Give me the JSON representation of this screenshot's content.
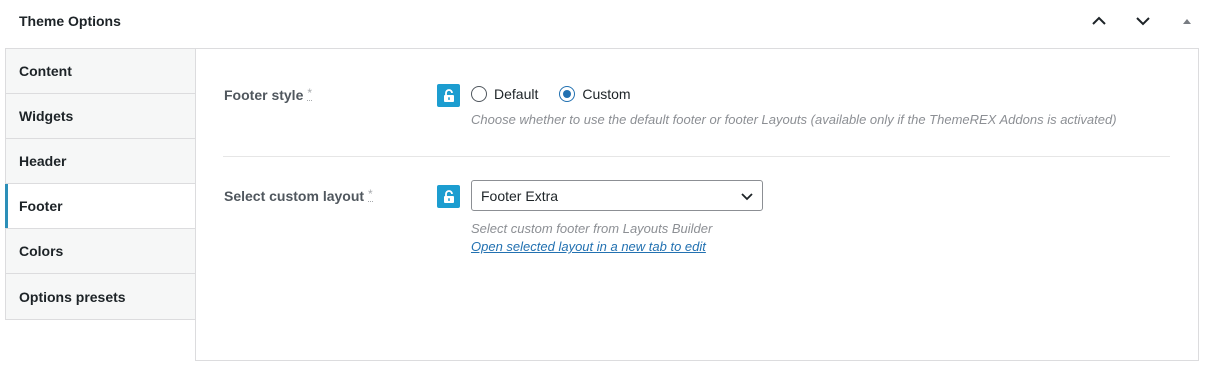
{
  "metabox": {
    "title": "Theme Options",
    "move_up_icon": "chevron-up-icon",
    "move_down_icon": "chevron-down-icon",
    "toggle_icon": "triangle-up-icon"
  },
  "tabs": [
    {
      "label": "Content"
    },
    {
      "label": "Widgets"
    },
    {
      "label": "Header"
    },
    {
      "label": "Footer",
      "active": true
    },
    {
      "label": "Colors"
    },
    {
      "label": "Options presets"
    }
  ],
  "fields": {
    "footer_style": {
      "label": "Footer style",
      "required_mark": "*",
      "options": [
        "Default",
        "Custom"
      ],
      "selected": "Custom",
      "description": "Choose whether to use the default footer or footer Layouts (available only if the ThemeREX Addons is activated)"
    },
    "custom_layout": {
      "label": "Select custom layout",
      "required_mark": "*",
      "value": "Footer Extra",
      "description": "Select custom footer from Layouts Builder",
      "link": "Open selected layout in a new tab to edit"
    }
  },
  "colors": {
    "accent": "#1c9dd0",
    "radio_checked": "#2271b1",
    "tab_active_bar": "#2c8fb8"
  },
  "icons": {
    "lock": "unlock-icon",
    "select_arrow": "chevron-down-icon"
  }
}
